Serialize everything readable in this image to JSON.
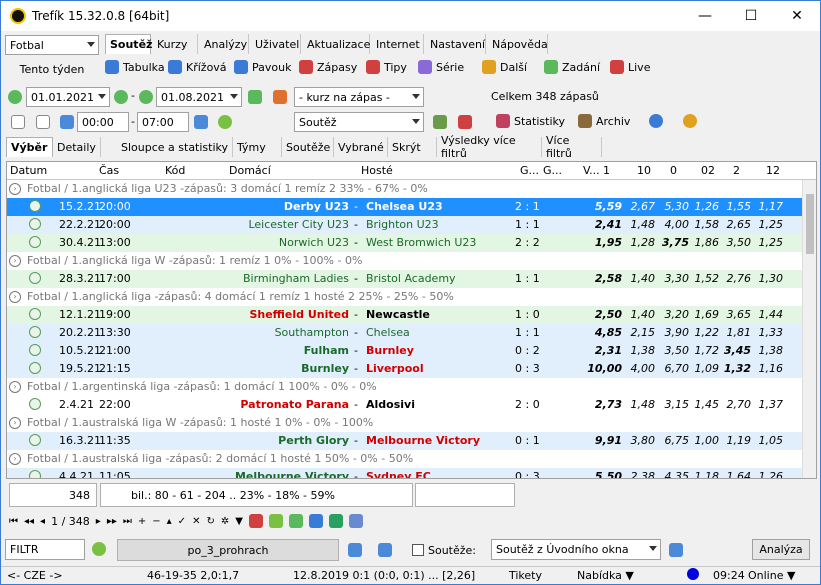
{
  "window": {
    "title": "Trefík 15.32.0.8 [64bit]",
    "min": "—",
    "max": "☐",
    "close": "✕"
  },
  "sport": "Fotbal",
  "week_label": "Tento týden",
  "main_tabs": [
    "Soutěž",
    "Kurzy",
    "Analýzy",
    "Uživatel",
    "Aktualizace",
    "Internet",
    "Nastavení",
    "Nápověda"
  ],
  "toolbar": [
    "Tabulka",
    "Křížová",
    "Pavouk",
    "Zápasy",
    "Tipy",
    "Série",
    "Další",
    "Zadání",
    "Live"
  ],
  "date_from": "01.01.2021",
  "date_to": "01.08.2021",
  "kurz_select": "- kurz na zápas -",
  "total": "Celkem 348 zápasů",
  "time_from": "00:00",
  "time_to": "07:00",
  "soutez_select": "Soutěž",
  "statistiky": "Statistiky",
  "archiv": "Archiv",
  "sub_tabs": [
    "Výběr",
    "Detaily",
    "Sloupce a statistiky",
    "Týmy",
    "Soutěže",
    "Vybrané",
    "Skrýt",
    "Výsledky více filtrů",
    "Více filtrů"
  ],
  "columns": [
    "Datum",
    "Čas",
    "Kód",
    "Domácí",
    "Hosté",
    "G...",
    "G...",
    "V...",
    "1",
    "10",
    "0",
    "02",
    "2",
    "12"
  ],
  "rows": [
    {
      "type": "group",
      "text": "Fotbal / 1.anglická liga U23 -zápasů: 3  domácí 1   remíz 2       33% - 67% - 0%"
    },
    {
      "type": "match",
      "style": "sel",
      "date": "15.2.21",
      "time": "20:00",
      "home": "Derby U23",
      "away": "Chelsea U23",
      "score": "2 : 1",
      "odds": [
        "5,59",
        "2,67",
        "5,30",
        "1,26",
        "1,55",
        "1,17"
      ],
      "home_red": false,
      "away_red": false
    },
    {
      "type": "match",
      "style": "blue",
      "date": "22.2.21",
      "time": "20:00",
      "home": "Leicester City U23",
      "away": "Brighton U23",
      "score": "1 : 1",
      "odds": [
        "2,41",
        "1,48",
        "4,00",
        "1,58",
        "2,65",
        "1,25"
      ],
      "home_red": false,
      "away_red": false
    },
    {
      "type": "match",
      "style": "green",
      "date": "30.4.21",
      "time": "13:00",
      "home": "Norwich U23",
      "away": "West Bromwich U23",
      "score": "2 : 2",
      "odds": [
        "1,95",
        "1,28",
        "3,75",
        "1,86",
        "3,50",
        "1,25"
      ],
      "home_red": false,
      "away_red": false
    },
    {
      "type": "group",
      "text": "Fotbal / 1.anglická liga W -zápasů: 1    remíz 1       0% - 100% - 0%"
    },
    {
      "type": "match",
      "style": "green",
      "date": "28.3.21",
      "time": "17:00",
      "home": "Birmingham Ladies",
      "away": "Bristol Academy",
      "score": "1 : 1",
      "odds": [
        "2,58",
        "1,40",
        "3,30",
        "1,52",
        "2,76",
        "1,30"
      ],
      "home_red": false,
      "away_red": false
    },
    {
      "type": "group",
      "text": "Fotbal / 1.anglická liga -zápasů: 4  domácí 1   remíz 1   hosté 2      25% - 25% - 50%"
    },
    {
      "type": "match",
      "style": "green",
      "date": "12.1.21",
      "time": "19:00",
      "home": "Sheffield United",
      "away": "Newcastle",
      "score": "1 : 0",
      "odds": [
        "2,50",
        "1,40",
        "3,20",
        "1,69",
        "3,65",
        "1,44"
      ],
      "home_red": true,
      "away_red": false
    },
    {
      "type": "match",
      "style": "blue",
      "date": "20.2.21",
      "time": "13:30",
      "home": "Southampton",
      "away": "Chelsea",
      "score": "1 : 1",
      "odds": [
        "4,85",
        "2,15",
        "3,90",
        "1,22",
        "1,81",
        "1,33"
      ],
      "home_red": false,
      "away_red": false
    },
    {
      "type": "match",
      "style": "blue",
      "date": "10.5.21",
      "time": "21:00",
      "home": "Fulham",
      "away": "Burnley",
      "score": "0 : 2",
      "odds": [
        "2,31",
        "1,38",
        "3,50",
        "1,72",
        "3,45",
        "1,38"
      ],
      "home_red": false,
      "away_red": true
    },
    {
      "type": "match",
      "style": "blue",
      "date": "19.5.21",
      "time": "21:15",
      "home": "Burnley",
      "away": "Liverpool",
      "score": "0 : 3",
      "odds": [
        "10,00",
        "4,00",
        "6,70",
        "1,09",
        "1,32",
        "1,16"
      ],
      "home_red": false,
      "away_red": true
    },
    {
      "type": "group",
      "text": "Fotbal / 1.argentinská liga -zápasů: 1  domácí 1        100% - 0% - 0%"
    },
    {
      "type": "match",
      "style": "white",
      "date": "2.4.21",
      "time": "22:00",
      "home": "Patronato Parana",
      "away": "Aldosivi",
      "score": "2 : 0",
      "odds": [
        "2,73",
        "1,48",
        "3,15",
        "1,45",
        "2,70",
        "1,37"
      ],
      "home_red": true,
      "away_red": false
    },
    {
      "type": "group",
      "text": "Fotbal / 1.australská liga W -zápasů: 1     hosté 1     0% - 0% - 100%"
    },
    {
      "type": "match",
      "style": "blue",
      "date": "16.3.21",
      "time": "11:35",
      "home": "Perth Glory",
      "away": "Melbourne Victory",
      "score": "0 : 1",
      "odds": [
        "9,91",
        "3,80",
        "6,75",
        "1,00",
        "1,19",
        "1,05"
      ],
      "home_red": false,
      "away_red": true
    },
    {
      "type": "group",
      "text": "Fotbal / 1.australská liga -zápasů: 2  domácí 1     hosté 1      50% - 0% - 50%"
    },
    {
      "type": "match",
      "style": "blue",
      "date": "4.4.21",
      "time": "11:05",
      "home": "Melbourne Victory",
      "away": "Sydney FC",
      "score": "0 : 3",
      "odds": [
        "5,50",
        "2,38",
        "4,35",
        "1,18",
        "1,64",
        "1,26"
      ],
      "home_red": false,
      "away_red": true
    }
  ],
  "count": "348",
  "bil": "bil.: 80 - 61 - 204 .. 23% - 18% - 59%",
  "pager": "1 / 348",
  "filter_label": "FILTR",
  "filter_name": "po_3_prohrach",
  "soutezi_label": "Soutěže:",
  "soutez_from": "Soutěž z Úvodního okna",
  "analyza": "Analýza",
  "status": [
    "<- CZE ->",
    "46-19-35  2,0:1,7",
    "12.8.2019 0:1 (0:0, 0:1) ... [2,26]",
    "Tikety",
    "Nabídka ▼",
    "09:24",
    "Online ▼"
  ]
}
